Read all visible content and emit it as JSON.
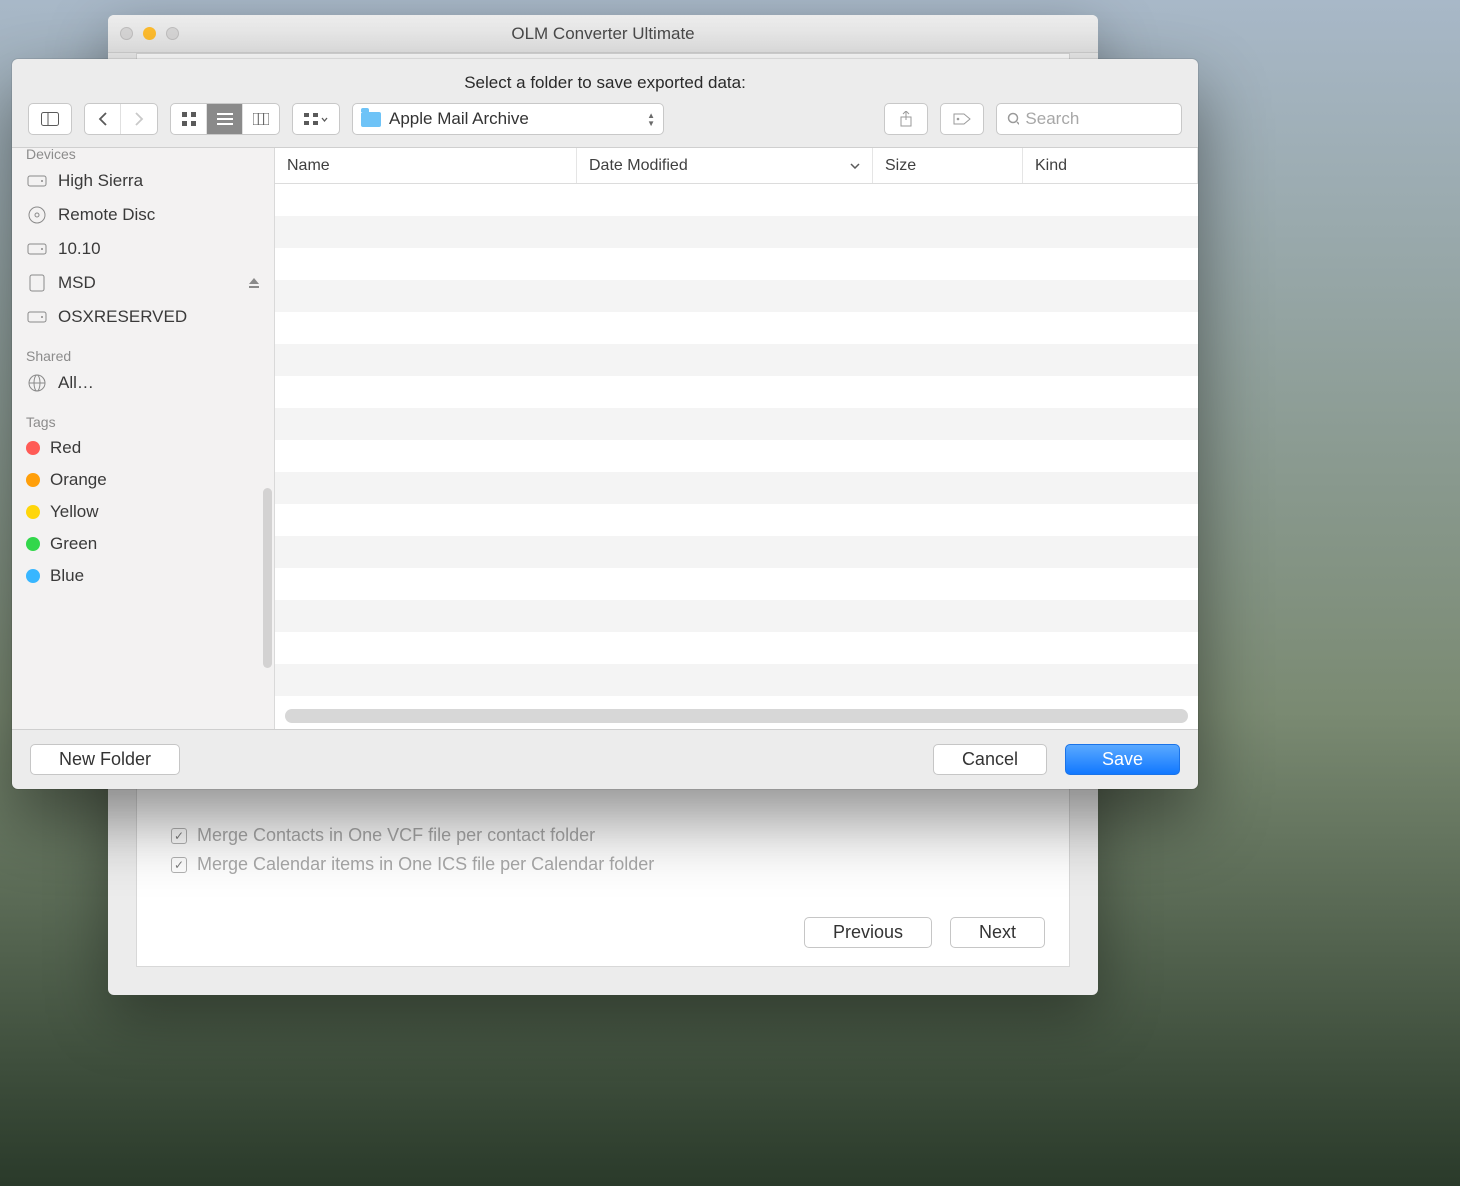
{
  "app": {
    "title": "OLM Converter Ultimate"
  },
  "sheet": {
    "prompt": "Select a folder to save exported data:",
    "location": "Apple Mail Archive",
    "search_placeholder": "Search",
    "new_folder_label": "New Folder",
    "cancel_label": "Cancel",
    "save_label": "Save"
  },
  "columns": {
    "name": "Name",
    "date": "Date Modified",
    "size": "Size",
    "kind": "Kind"
  },
  "sidebar": {
    "devices_header": "Devices",
    "devices": [
      {
        "label": "High Sierra",
        "icon": "hdd"
      },
      {
        "label": "Remote Disc",
        "icon": "disc"
      },
      {
        "label": "10.10",
        "icon": "hdd"
      },
      {
        "label": "MSD",
        "icon": "external",
        "eject": true
      },
      {
        "label": "OSXRESERVED",
        "icon": "hdd"
      }
    ],
    "shared_header": "Shared",
    "shared": [
      {
        "label": "All…",
        "icon": "globe"
      }
    ],
    "tags_header": "Tags",
    "tags": [
      {
        "label": "Red",
        "color": "#ff5b56"
      },
      {
        "label": "Orange",
        "color": "#ff9f0a"
      },
      {
        "label": "Yellow",
        "color": "#ffd60a"
      },
      {
        "label": "Green",
        "color": "#32d74b"
      },
      {
        "label": "Blue",
        "color": "#38b6ff"
      }
    ]
  },
  "background": {
    "merge_contacts_label": "Merge Contacts in One VCF file per contact folder",
    "merge_calendar_label": "Merge Calendar items in One ICS file per Calendar folder",
    "previous_label": "Previous",
    "next_label": "Next"
  }
}
